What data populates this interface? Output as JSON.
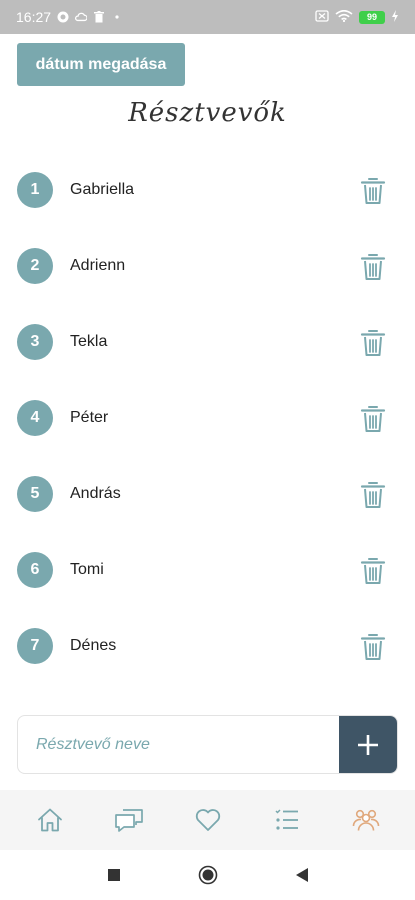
{
  "status_bar": {
    "time": "16:27",
    "battery": "99"
  },
  "header": {
    "date_button_label": "dátum megadása",
    "title": "Résztvevők"
  },
  "participants": [
    {
      "number": "1",
      "name": "Gabriella"
    },
    {
      "number": "2",
      "name": "Adrienn"
    },
    {
      "number": "3",
      "name": "Tekla"
    },
    {
      "number": "4",
      "name": "Péter"
    },
    {
      "number": "5",
      "name": "András"
    },
    {
      "number": "6",
      "name": "Tomi"
    },
    {
      "number": "7",
      "name": "Dénes"
    }
  ],
  "add_form": {
    "placeholder": "Résztvevő neve",
    "value": "",
    "add_icon": "plus-icon"
  },
  "bottom_nav": {
    "items": [
      {
        "icon": "home-icon"
      },
      {
        "icon": "chat-icon"
      },
      {
        "icon": "heart-icon"
      },
      {
        "icon": "list-icon"
      },
      {
        "icon": "people-icon",
        "active": true
      }
    ]
  },
  "colors": {
    "accent": "#7aa8ae",
    "dark_button": "#3f5566",
    "active_nav": "#e0a87c"
  }
}
